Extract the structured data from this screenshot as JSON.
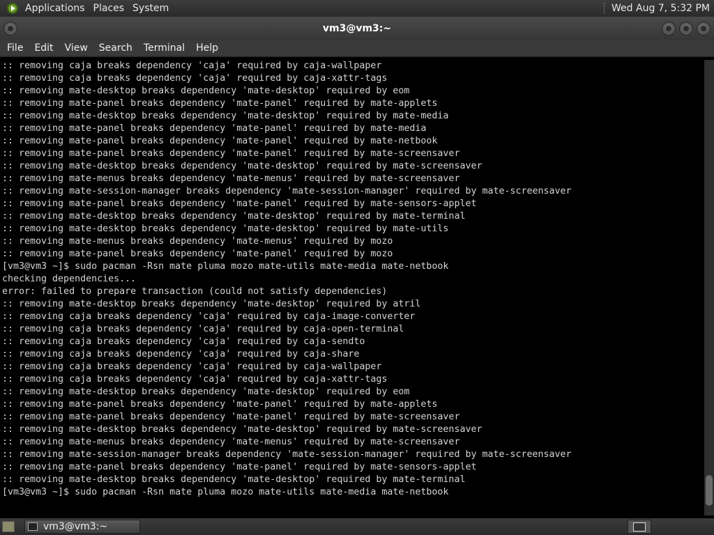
{
  "top_panel": {
    "menus": [
      "Applications",
      "Places",
      "System"
    ],
    "clock": "Wed Aug  7, 5:32 PM"
  },
  "window": {
    "title": "vm3@vm3:~"
  },
  "menubar": {
    "items": [
      "File",
      "Edit",
      "View",
      "Search",
      "Terminal",
      "Help"
    ]
  },
  "terminal": {
    "lines": [
      ":: removing caja breaks dependency 'caja' required by caja-wallpaper",
      ":: removing caja breaks dependency 'caja' required by caja-xattr-tags",
      ":: removing mate-desktop breaks dependency 'mate-desktop' required by eom",
      ":: removing mate-panel breaks dependency 'mate-panel' required by mate-applets",
      ":: removing mate-desktop breaks dependency 'mate-desktop' required by mate-media",
      ":: removing mate-panel breaks dependency 'mate-panel' required by mate-media",
      ":: removing mate-panel breaks dependency 'mate-panel' required by mate-netbook",
      ":: removing mate-panel breaks dependency 'mate-panel' required by mate-screensaver",
      ":: removing mate-desktop breaks dependency 'mate-desktop' required by mate-screensaver",
      ":: removing mate-menus breaks dependency 'mate-menus' required by mate-screensaver",
      ":: removing mate-session-manager breaks dependency 'mate-session-manager' required by mate-screensaver",
      ":: removing mate-panel breaks dependency 'mate-panel' required by mate-sensors-applet",
      ":: removing mate-desktop breaks dependency 'mate-desktop' required by mate-terminal",
      ":: removing mate-desktop breaks dependency 'mate-desktop' required by mate-utils",
      ":: removing mate-menus breaks dependency 'mate-menus' required by mozo",
      ":: removing mate-panel breaks dependency 'mate-panel' required by mozo",
      "[vm3@vm3 ~]$ sudo pacman -Rsn mate pluma mozo mate-utils mate-media mate-netbook",
      "checking dependencies...",
      "error: failed to prepare transaction (could not satisfy dependencies)",
      ":: removing mate-desktop breaks dependency 'mate-desktop' required by atril",
      ":: removing caja breaks dependency 'caja' required by caja-image-converter",
      ":: removing caja breaks dependency 'caja' required by caja-open-terminal",
      ":: removing caja breaks dependency 'caja' required by caja-sendto",
      ":: removing caja breaks dependency 'caja' required by caja-share",
      ":: removing caja breaks dependency 'caja' required by caja-wallpaper",
      ":: removing caja breaks dependency 'caja' required by caja-xattr-tags",
      ":: removing mate-desktop breaks dependency 'mate-desktop' required by eom",
      ":: removing mate-panel breaks dependency 'mate-panel' required by mate-applets",
      ":: removing mate-panel breaks dependency 'mate-panel' required by mate-screensaver",
      ":: removing mate-desktop breaks dependency 'mate-desktop' required by mate-screensaver",
      ":: removing mate-menus breaks dependency 'mate-menus' required by mate-screensaver",
      ":: removing mate-session-manager breaks dependency 'mate-session-manager' required by mate-screensaver",
      ":: removing mate-panel breaks dependency 'mate-panel' required by mate-sensors-applet",
      ":: removing mate-desktop breaks dependency 'mate-desktop' required by mate-terminal",
      "[vm3@vm3 ~]$ sudo pacman -Rsn mate pluma mozo mate-utils mate-media mate-netbook"
    ]
  },
  "taskbar": {
    "task_label": "vm3@vm3:~"
  }
}
